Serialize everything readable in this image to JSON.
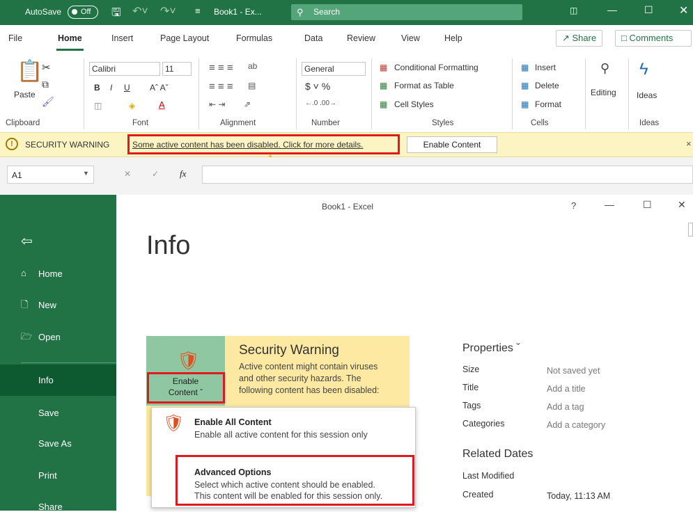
{
  "titlebar": {
    "autosave_label": "AutoSave",
    "autosave_state": "Off",
    "file_title": "Book1 - Ex...",
    "search_placeholder": "Search",
    "accent": "#217346"
  },
  "tabs": [
    "File",
    "Home",
    "Insert",
    "Page Layout",
    "Formulas",
    "Data",
    "Review",
    "View",
    "Help"
  ],
  "share_label": "Share",
  "comments_label": "Comments",
  "ribbon": {
    "paste": "Paste",
    "font_name": "Calibri",
    "font_size": "11",
    "number_format": "General",
    "conditional_formatting": "Conditional Formatting",
    "format_as_table": "Format as Table",
    "cell_styles": "Cell Styles",
    "insert": "Insert",
    "delete": "Delete",
    "format": "Format",
    "editing": "Editing",
    "ideas": "Ideas",
    "groups": {
      "clipboard": "Clipboard",
      "font": "Font",
      "alignment": "Alignment",
      "number": "Number",
      "styles": "Styles",
      "cells": "Cells",
      "ideas": "Ideas"
    }
  },
  "security_bar": {
    "title": "SECURITY WARNING",
    "message": "Some active content has been disabled. Click for more details.",
    "button": "Enable Content"
  },
  "formula_bar": {
    "name_box": "A1"
  },
  "backstage": {
    "window_title": "Book1 - Excel",
    "help": "?",
    "page_title": "Info",
    "nav": [
      "Home",
      "New",
      "Open",
      "Info",
      "Save",
      "Save As",
      "Print",
      "Share"
    ],
    "security_warning_title": "Security Warning",
    "security_warning_text_1": "Active content might contain viruses",
    "security_warning_text_2": "and other security hazards. The",
    "security_warning_text_3": "following content has been disabled:",
    "enable_content_line1": "Enable",
    "enable_content_line2": "Content",
    "menu": {
      "enable_all_title": "Enable All Content",
      "enable_all_desc": "Enable all active content for this session only",
      "advanced_title": "Advanced Options",
      "advanced_desc_1": "Select which active content should be enabled.",
      "advanced_desc_2": "This content will be enabled for this session only."
    },
    "properties_title": "Properties",
    "properties": [
      {
        "label": "Size",
        "value": "Not saved yet"
      },
      {
        "label": "Title",
        "value": "Add a title"
      },
      {
        "label": "Tags",
        "value": "Add a tag"
      },
      {
        "label": "Categories",
        "value": "Add a category"
      }
    ],
    "related_dates_title": "Related Dates",
    "last_modified": "Last Modified",
    "created": "Created",
    "created_value": "Today, 11:13 AM"
  }
}
